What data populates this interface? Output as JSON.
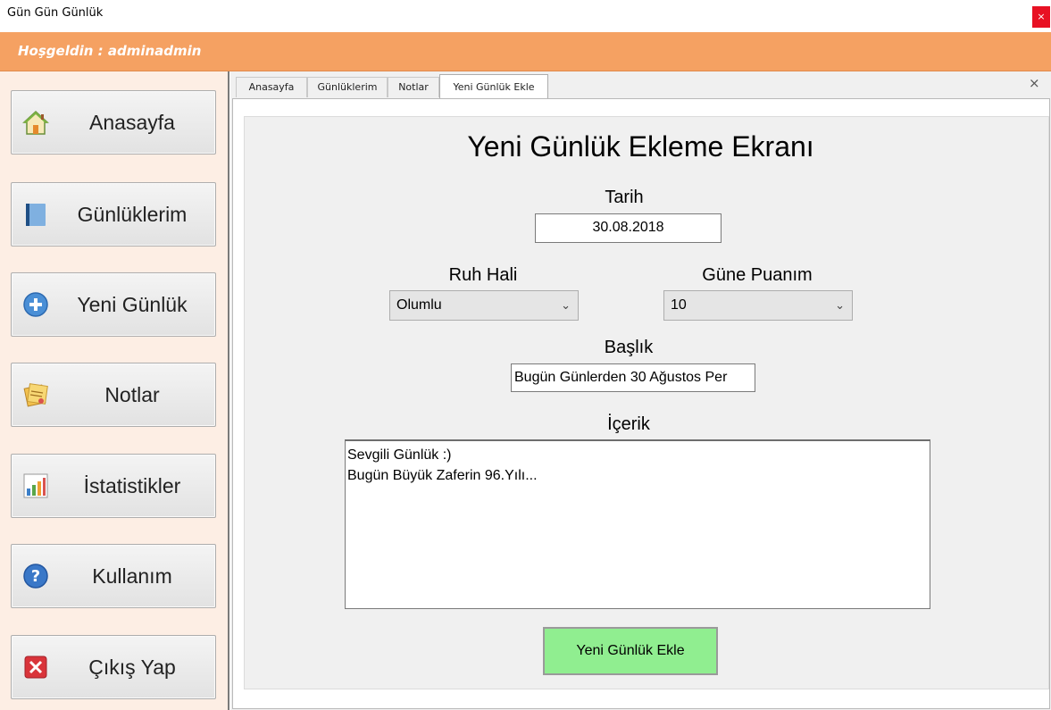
{
  "window": {
    "title": "Gün Gün Günlük",
    "close_glyph": "×"
  },
  "header": {
    "welcome": "Hoşgeldin : adminadmin",
    "accent_color": "#f5a162"
  },
  "sidebar": {
    "items": [
      {
        "label": "Anasayfa",
        "icon": "home-icon"
      },
      {
        "label": "Günlüklerim",
        "icon": "book-icon"
      },
      {
        "label": "Yeni Günlük",
        "icon": "plus-circle-icon"
      },
      {
        "label": "Notlar",
        "icon": "notes-icon"
      },
      {
        "label": "İstatistikler",
        "icon": "bar-chart-icon"
      },
      {
        "label": "Kullanım",
        "icon": "help-icon"
      },
      {
        "label": "Çıkış Yap",
        "icon": "exit-icon"
      }
    ]
  },
  "tabs": {
    "items": [
      {
        "label": "Anasayfa"
      },
      {
        "label": "Günlüklerim"
      },
      {
        "label": "Notlar"
      },
      {
        "label": "Yeni Günlük Ekle",
        "active": true
      }
    ],
    "close_glyph": "×"
  },
  "form": {
    "title": "Yeni Günlük Ekleme Ekranı",
    "date_label": "Tarih",
    "date_value": "30.08.2018",
    "mood_label": "Ruh Hali",
    "mood_value": "Olumlu",
    "score_label": "Güne Puanım",
    "score_value": "10",
    "heading_label": "Başlık",
    "heading_value": "Bugün Günlerden 30 Ağustos Per",
    "content_label": "İçerik",
    "content_value": "Sevgili Günlük :)\nBugün Büyük Zaferin 96.Yılı...",
    "submit_label": "Yeni Günlük Ekle",
    "submit_color": "#90ee90"
  }
}
